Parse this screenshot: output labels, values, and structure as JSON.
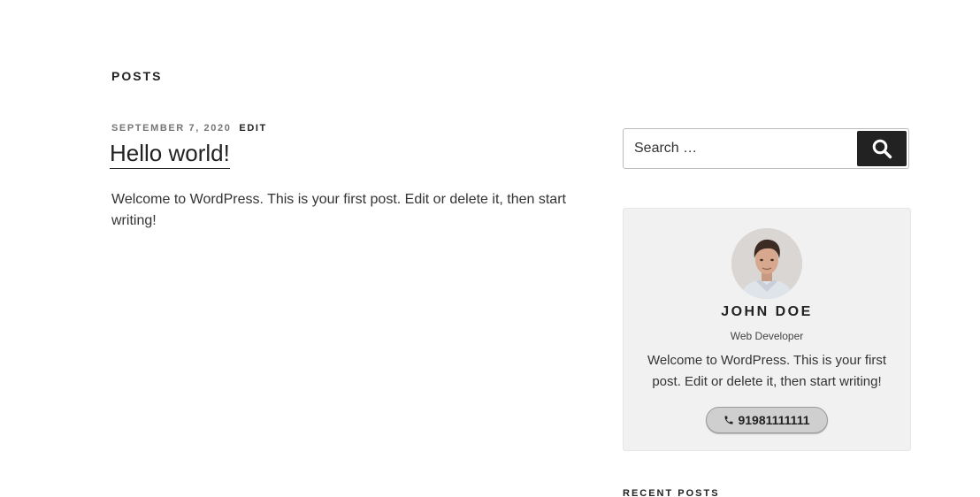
{
  "main": {
    "section_title": "POSTS",
    "post": {
      "date": "SEPTEMBER 7, 2020",
      "edit_label": "EDIT",
      "title": "Hello world!",
      "excerpt": "Welcome to WordPress. This is your first post. Edit or delete it, then start writing!"
    }
  },
  "sidebar": {
    "search": {
      "placeholder": "Search …",
      "button_icon": "search-icon"
    },
    "profile": {
      "name": "JOHN DOE",
      "role": "Web Developer",
      "bio": "Welcome to WordPress. This is your first post. Edit or delete it, then start writing!",
      "phone": "91981111111",
      "phone_icon": "phone-icon"
    },
    "recent_posts_title": "RECENT POSTS"
  }
}
